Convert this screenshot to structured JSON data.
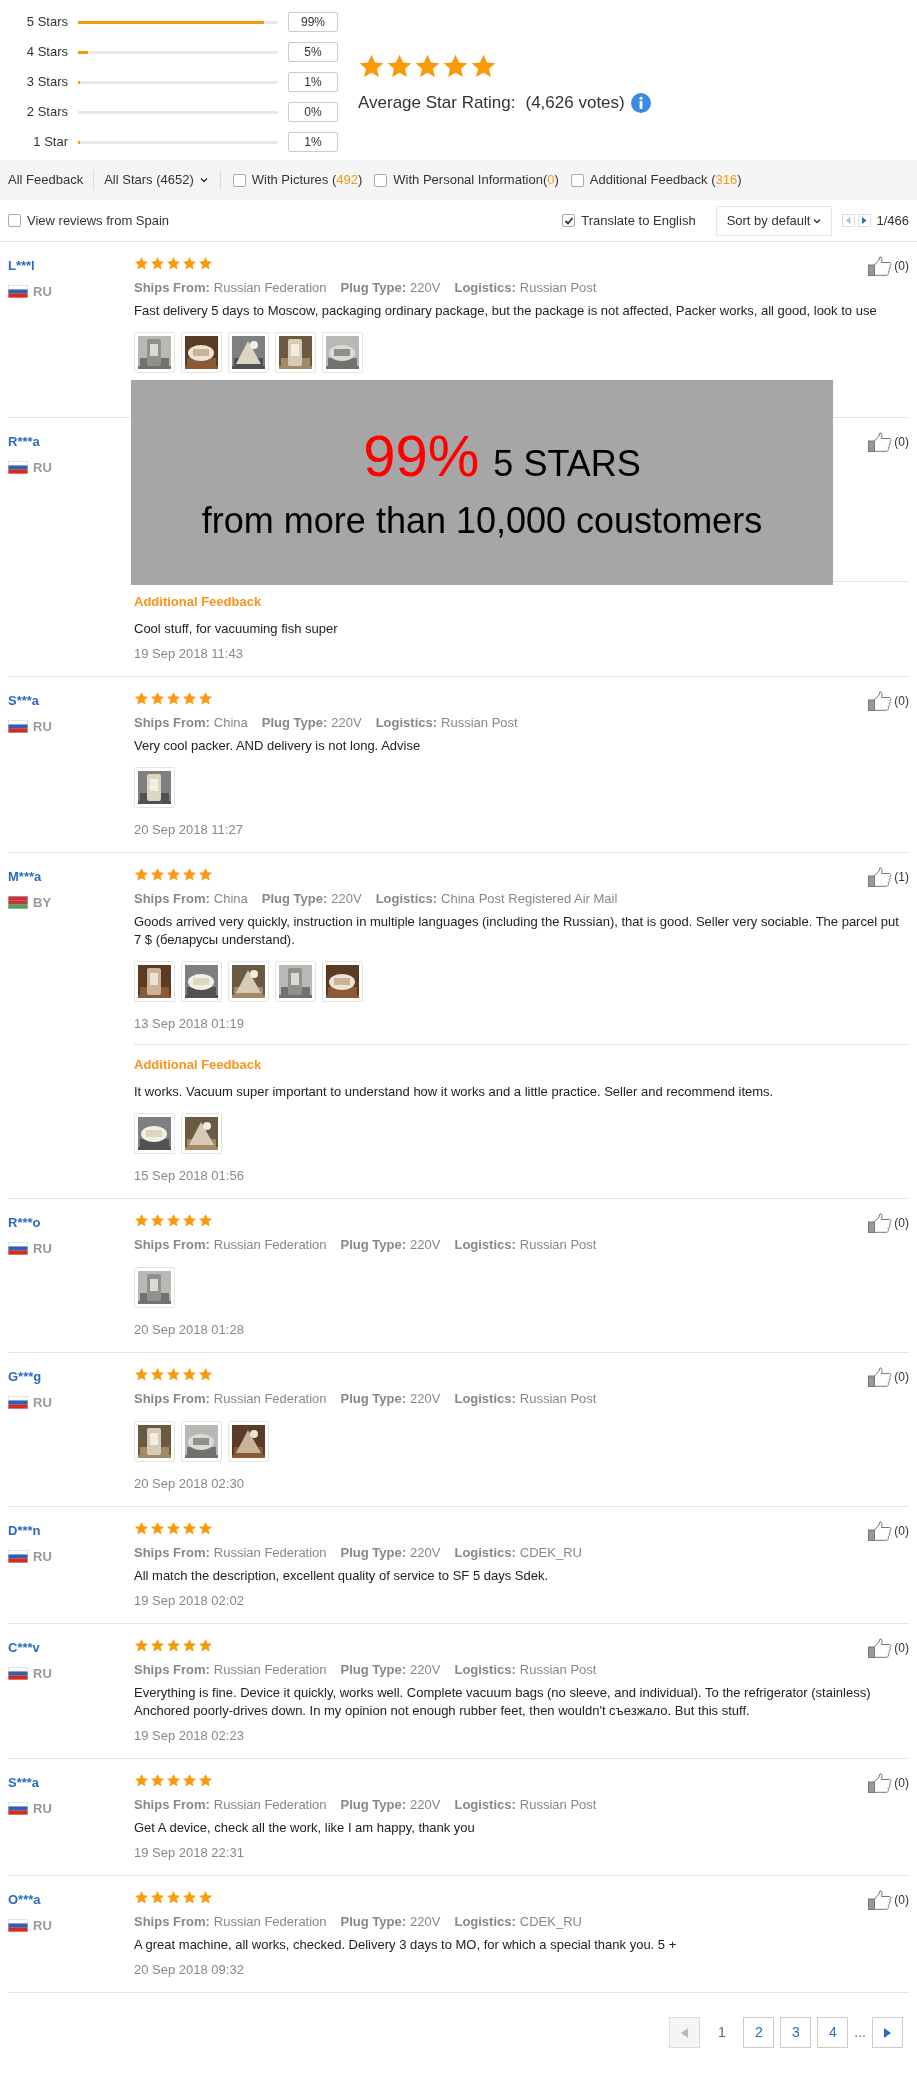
{
  "histogram": [
    {
      "label": "5 Stars",
      "level": 0.93,
      "percent": "99%"
    },
    {
      "label": "4 Stars",
      "level": 0.05,
      "percent": "5%"
    },
    {
      "label": "3 Stars",
      "level": 0.01,
      "percent": "1%"
    },
    {
      "label": "2 Stars",
      "percent": "0%"
    },
    {
      "label": "1 Star",
      "level": 0.01,
      "percent": "1%"
    }
  ],
  "summary": {
    "stars": 5,
    "label": "Average Star Rating:",
    "votes": "(4,626 votes)"
  },
  "filters": {
    "all_feedback": "All Feedback",
    "star_select": "All Stars (4652)",
    "checkboxes": [
      {
        "label": "With Pictures (",
        "count": "492",
        "suffix": ")",
        "checked": false
      },
      {
        "label": "With Personal Information(",
        "count": "0",
        "suffix": ")",
        "checked": false
      },
      {
        "label": "Additional Feedback (",
        "count": "316",
        "suffix": ")",
        "checked": false
      }
    ]
  },
  "options": {
    "spain": {
      "label": "View reviews from Spain",
      "checked": false
    },
    "translate": {
      "label": "Translate to English",
      "checked": true
    },
    "sort": "Sort by default",
    "page": "1/466"
  },
  "reviews": [
    {
      "name": "L***l",
      "flag": {
        "kind": "ru"
      },
      "country": "RU",
      "stars": 5,
      "details": [
        {
          "label": "Ships From:",
          "value": "Russian Federation"
        },
        {
          "label": "Plug Type:",
          "value": "220V"
        },
        {
          "label": "Logistics:",
          "value": "Russian Post"
        }
      ],
      "text": "Fast delivery 5 days to Moscow, packaging ordinary package, but the package is not affected, Packer works, all good, look to use",
      "photos": [
        {
          "kind": "picture"
        },
        {
          "kind": "picture"
        },
        {
          "kind": "picture"
        },
        {
          "kind": "picture"
        },
        {
          "kind": "picture"
        }
      ],
      "likes": "(0)"
    },
    {
      "name": "R***a",
      "flag": {
        "kind": "ru"
      },
      "country": "RU",
      "likes": "(0)",
      "additional": {
        "title": "Additional Feedback",
        "text": "Cool stuff, for vacuuming fish super",
        "date": "19 Sep 2018 11:43"
      }
    },
    {
      "name": "S***a",
      "flag": {
        "kind": "ru"
      },
      "country": "RU",
      "stars": 5,
      "details": [
        {
          "label": "Ships From:",
          "value": "China"
        },
        {
          "label": "Plug Type:",
          "value": "220V"
        },
        {
          "label": "Logistics:",
          "value": "Russian Post"
        }
      ],
      "text": "Very cool packer. AND delivery is not long. Advise",
      "photos": [
        {
          "kind": "picture"
        }
      ],
      "date": "20 Sep 2018 11:27",
      "likes": "(0)"
    },
    {
      "name": "M***a",
      "flag": {
        "kind": "by"
      },
      "country": "BY",
      "stars": 5,
      "details": [
        {
          "label": "Ships From:",
          "value": "China"
        },
        {
          "label": "Plug Type:",
          "value": "220V"
        },
        {
          "label": "Logistics:",
          "value": "China Post Registered Air Mail"
        }
      ],
      "text": "Goods arrived very quickly, instruction in multiple languages (including the Russian), that is good. Seller very sociable. The parcel put 7 $ (беларусы understand).",
      "photos": [
        {
          "kind": "picture"
        },
        {
          "kind": "picture"
        },
        {
          "kind": "picture"
        },
        {
          "kind": "picture"
        },
        {
          "kind": "picture"
        }
      ],
      "date": "13 Sep 2018 01:19",
      "likes": "(1)",
      "additional": {
        "title": "Additional Feedback",
        "text": "It works. Vacuum super important to understand how it works and a little practice. Seller and recommend items.",
        "photos": [
          {
            "kind": "picture"
          },
          {
            "kind": "picture"
          }
        ],
        "date": "15 Sep 2018 01:56"
      }
    },
    {
      "name": "R***o",
      "flag": {
        "kind": "ru"
      },
      "country": "RU",
      "stars": 5,
      "details": [
        {
          "label": "Ships From:",
          "value": "Russian Federation"
        },
        {
          "label": "Plug Type:",
          "value": "220V"
        },
        {
          "label": "Logistics:",
          "value": "Russian Post"
        }
      ],
      "photos": [
        {
          "kind": "picture"
        }
      ],
      "date": "20 Sep 2018 01:28",
      "likes": "(0)"
    },
    {
      "name": "G***g",
      "flag": {
        "kind": "ru"
      },
      "country": "RU",
      "stars": 5,
      "details": [
        {
          "label": "Ships From:",
          "value": "Russian Federation"
        },
        {
          "label": "Plug Type:",
          "value": "220V"
        },
        {
          "label": "Logistics:",
          "value": "Russian Post"
        }
      ],
      "photos": [
        {
          "kind": "picture"
        },
        {
          "kind": "picture"
        },
        {
          "kind": "picture"
        }
      ],
      "date": "20 Sep 2018 02:30",
      "likes": "(0)"
    },
    {
      "name": "D***n",
      "flag": {
        "kind": "ru"
      },
      "country": "RU",
      "stars": 5,
      "details": [
        {
          "label": "Ships From:",
          "value": "Russian Federation"
        },
        {
          "label": "Plug Type:",
          "value": "220V"
        },
        {
          "label": "Logistics:",
          "value": "CDEK_RU"
        }
      ],
      "text": "All match the description, excellent quality of service to SF 5 days Sdek.",
      "date": "19 Sep 2018 02:02",
      "likes": "(0)"
    },
    {
      "name": "C***v",
      "flag": {
        "kind": "ru"
      },
      "country": "RU",
      "stars": 5,
      "details": [
        {
          "label": "Ships From:",
          "value": "Russian Federation"
        },
        {
          "label": "Plug Type:",
          "value": "220V"
        },
        {
          "label": "Logistics:",
          "value": "Russian Post"
        }
      ],
      "text": "Everything is fine. Device it quickly, works well. Complete vacuum bags (no sleeve, and individual). To the refrigerator (stainless) Anchored poorly-drives down. In my opinion not enough rubber feet, then wouldn't съезжало. But this stuff.",
      "date": "19 Sep 2018 02:23",
      "likes": "(0)"
    },
    {
      "name": "S***a",
      "flag": {
        "kind": "ru"
      },
      "country": "RU",
      "stars": 5,
      "details": [
        {
          "label": "Ships From:",
          "value": "Russian Federation"
        },
        {
          "label": "Plug Type:",
          "value": "220V"
        },
        {
          "label": "Logistics:",
          "value": "Russian Post"
        }
      ],
      "text": "Get A device, check all the work, like I am happy, thank you",
      "date": "19 Sep 2018 22:31",
      "likes": "(0)"
    },
    {
      "name": "O***a",
      "flag": {
        "kind": "ru"
      },
      "country": "RU",
      "stars": 5,
      "details": [
        {
          "label": "Ships From:",
          "value": "Russian Federation"
        },
        {
          "label": "Plug Type:",
          "value": "220V"
        },
        {
          "label": "Logistics:",
          "value": "CDEK_RU"
        }
      ],
      "text": "A great machine, all works, checked. Delivery 3 days to MO, for which a special thank you. 5 +",
      "date": "20 Sep 2018 09:32",
      "likes": "(0)"
    }
  ],
  "pagination": {
    "prev_disabled": true,
    "pages": [
      {
        "label": "1",
        "selected": true
      },
      {
        "label": "2",
        "selected": false
      },
      {
        "label": "3",
        "selected": false
      },
      {
        "label": "4",
        "selected": false
      }
    ],
    "ellipsis": "...",
    "next_disabled": false
  },
  "banner": {
    "percent": "99%",
    "stars_text": "5 STARS",
    "subtitle": "from more than 10,000 coustomers"
  }
}
